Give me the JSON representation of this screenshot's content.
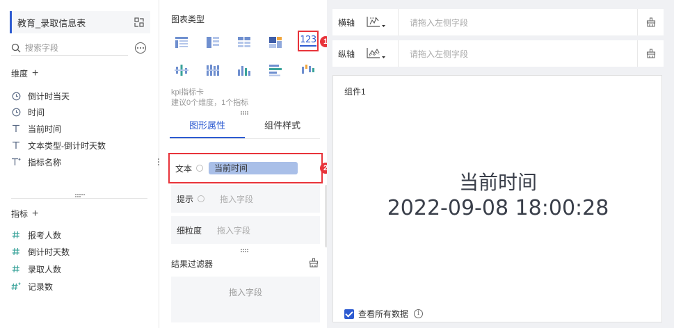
{
  "datasource": {
    "name": "教育_录取信息表"
  },
  "search": {
    "placeholder": "搜索字段"
  },
  "dimensions": {
    "label": "维度",
    "items": [
      {
        "icon": "clock-icon",
        "label": "倒计时当天"
      },
      {
        "icon": "clock-icon",
        "label": "时间"
      },
      {
        "icon": "text-type-icon",
        "label": "当前时间"
      },
      {
        "icon": "text-type-icon",
        "label": "文本类型-倒计时天数"
      },
      {
        "icon": "text-type-star-icon",
        "label": "指标名称"
      }
    ]
  },
  "measures": {
    "label": "指标",
    "items": [
      {
        "icon": "hash-icon",
        "label": "报考人数"
      },
      {
        "icon": "hash-icon",
        "label": "倒计时天数"
      },
      {
        "icon": "hash-icon",
        "label": "录取人数"
      },
      {
        "icon": "hash-star-icon",
        "label": "记录数"
      }
    ]
  },
  "chart_type": {
    "title": "图表类型",
    "selected_label": "123",
    "name": "kpi指标卡",
    "hint": "建议0个维度，1个指标",
    "badge1": "1",
    "badge2": "2"
  },
  "tabs": {
    "shape_props": "图形属性",
    "component_style": "组件样式"
  },
  "props": {
    "text_label": "文本",
    "text_value": "当前时间",
    "tip_label": "提示",
    "tip_placeholder": "拖入字段",
    "granularity_label": "细粒度",
    "granularity_placeholder": "拖入字段"
  },
  "filter": {
    "title": "结果过滤器",
    "placeholder": "拖入字段"
  },
  "axes": {
    "x_label": "横轴",
    "x_placeholder": "请拖入左侧字段",
    "y_label": "纵轴",
    "y_placeholder": "请拖入左侧字段"
  },
  "canvas": {
    "component_title": "组件1",
    "kpi_title": "当前时间",
    "kpi_value": "2022-09-08 18:00:28",
    "view_all_label": "查看所有数据"
  },
  "colors": {
    "accent": "#2d5bd1",
    "highlight": "#e8333a",
    "chip": "#a9bfe8"
  }
}
